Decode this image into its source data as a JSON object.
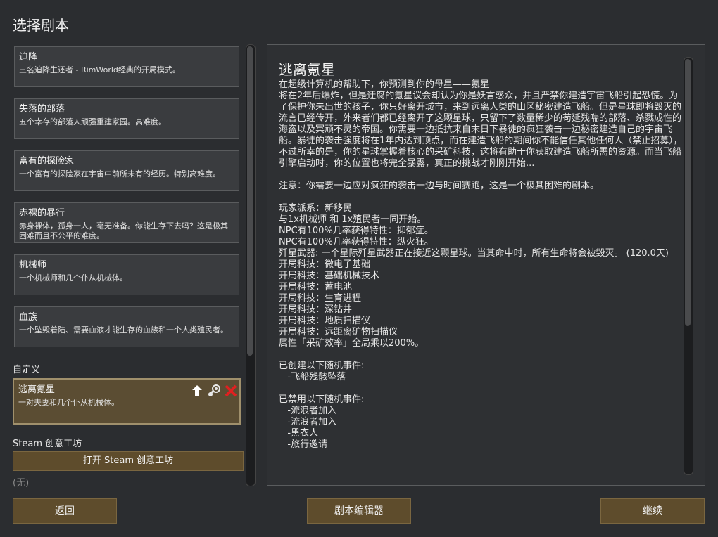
{
  "page_title": "选择剧本",
  "scenarios": [
    {
      "name": "迫降",
      "desc": "三名迫降生还者 - RimWorld经典的开局模式。"
    },
    {
      "name": "失落的部落",
      "desc": "五个幸存的部落人顽强重建家园。高难度。"
    },
    {
      "name": "富有的探险家",
      "desc": "一个富有的探险家在宇宙中前所未有的经历。特别高难度。"
    },
    {
      "name": "赤裸的暴行",
      "desc": "赤身裸体，孤身一人，毫无准备。你能生存下去吗？这是极其困难而且不公平的难度。"
    },
    {
      "name": "机械师",
      "desc": "一个机械师和几个仆从机械体。"
    },
    {
      "name": "血族",
      "desc": "一个坠毁着陆、需要血液才能生存的血族和一个人类殖民者。"
    }
  ],
  "custom": {
    "section_label": "自定义",
    "selected_scenario": {
      "name": "逃离氪星",
      "desc": "一对夫妻和几个仆从机械体。"
    },
    "icons": {
      "upload": "upload-arrow-icon",
      "steam": "steam-icon",
      "delete": "delete-x-icon"
    }
  },
  "workshop": {
    "section_label": "Steam 创意工坊",
    "open_button": "打开 Steam 创意工坊",
    "empty_label": "(无)"
  },
  "detail": {
    "title": "逃离氪星",
    "body": "在超级计算机的帮助下，你预测到你的母星——氪星\n将在2年后爆炸，但是迂腐的氪星议会却认为你是妖言惑众，并且严禁你建造宇宙飞船引起恐慌。为了保护你未出世的孩子，你只好离开城市，来到远离人类的山区秘密建造飞船。但是星球即将毁灭的流言已经传开，外来者们都已经离开了这颗星球，只留下了数量稀少的苟延残喘的部落、杀戮成性的海盗以及冥顽不灵的帝国。你需要一边抵抗来自末日下暴徒的疯狂袭击一边秘密建造自己的宇宙飞船。暴徒的袭击强度将在1年内达到顶点，而在建造飞船的期间你不能信任其他任何人（禁止招募），不过所幸的是，你的星球掌握着核心的采矿科技，这将有助于你获取建造飞船所需的资源。而当飞船引擎启动时，你的位置也将完全暴露，真正的挑战才刚刚开始...\n\n注意：你需要一边应对疯狂的袭击一边与时间赛跑，这是一个极其困难的剧本。\n\n玩家派系：新移民\n与1x机械师 和 1x殖民者一同开始。\nNPC有100%几率获得特性：抑郁症。\nNPC有100%几率获得特性：纵火狂。\n歼星武器: 一个星际歼星武器正在接近这颗星球。当其命中时，所有生命将会被毁灭。 (120.0天)\n开局科技：微电子基础\n开局科技：基础机械技术\n开局科技：蓄电池\n开局科技：生育进程\n开局科技：深钻井\n开局科技：地质扫描仪\n开局科技：远距离矿物扫描仪\n属性「采矿效率」全局乘以200%。\n\n已创建以下随机事件:\n   -飞船残骸坠落\n\n已禁用以下随机事件:\n   -流浪者加入\n   -流浪者加入\n   -黑衣人\n   -旅行邀请"
  },
  "buttons": {
    "back": "返回",
    "editor": "剧本编辑器",
    "continue": "继续"
  }
}
